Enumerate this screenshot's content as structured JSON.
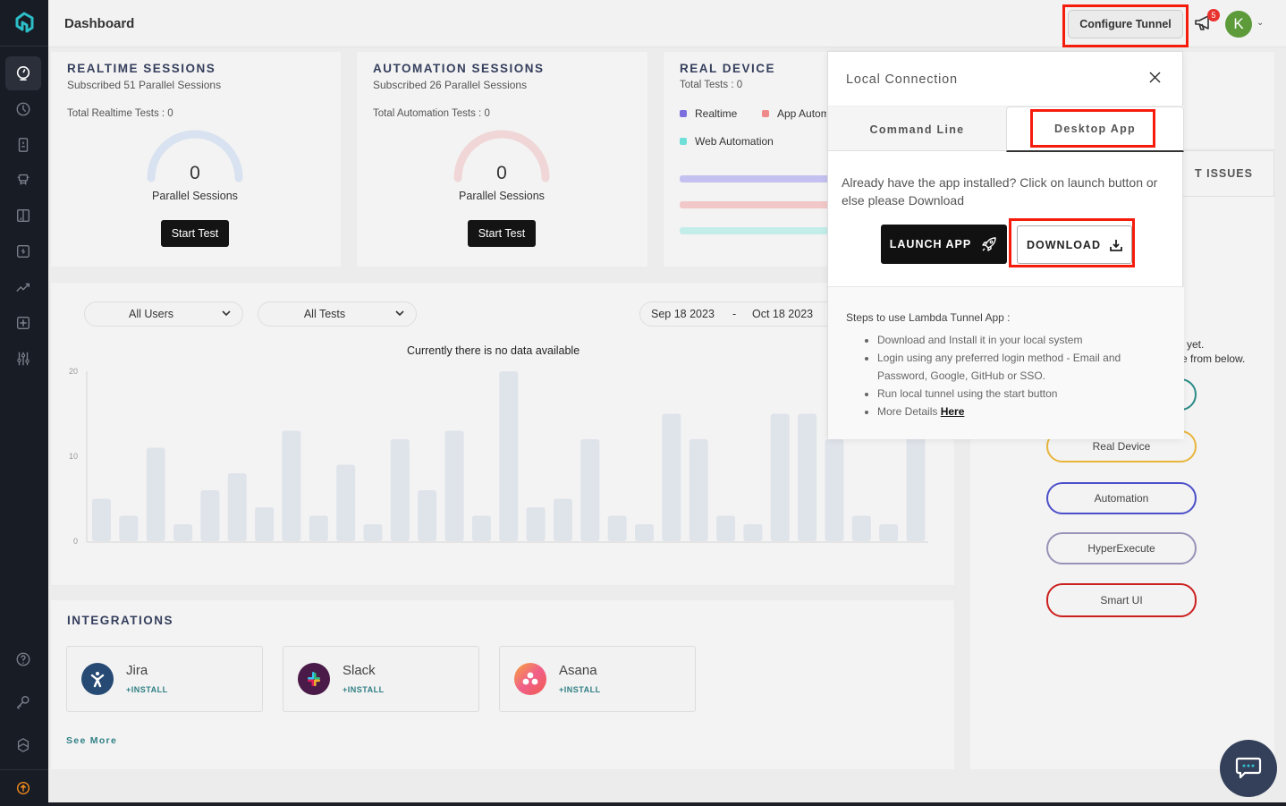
{
  "header": {
    "title": "Dashboard",
    "configure_tunnel": "Configure Tunnel",
    "notification_count": "5",
    "avatar_initial": "K"
  },
  "sidebar": {
    "items": [
      {
        "icon": "dashboard-icon",
        "active": true
      },
      {
        "icon": "history-clock-icon"
      },
      {
        "icon": "real-device-icon"
      },
      {
        "icon": "automation-robot-icon"
      },
      {
        "icon": "visual-compare-icon"
      },
      {
        "icon": "hyperexecute-icon"
      },
      {
        "icon": "analytics-icon"
      },
      {
        "icon": "add-integration-icon"
      },
      {
        "icon": "settings-sliders-icon"
      }
    ],
    "bottom_items": [
      {
        "icon": "help-icon"
      },
      {
        "icon": "access-key-icon"
      },
      {
        "icon": "integrations-icon"
      },
      {
        "icon": "upgrade-icon"
      }
    ]
  },
  "realtime": {
    "title": "REALTIME SESSIONS",
    "subscribed": "Subscribed 51 Parallel Sessions",
    "total": "Total Realtime Tests : 0",
    "value": "0",
    "label": "Parallel Sessions",
    "button": "Start Test"
  },
  "automation": {
    "title": "AUTOMATION SESSIONS",
    "subscribed": "Subscribed 26 Parallel Sessions",
    "total": "Total Automation Tests : 0",
    "value": "0",
    "label": "Parallel Sessions",
    "button": "Start Test"
  },
  "real_device": {
    "title": "REAL DEVICE",
    "total": "Total Tests : 0",
    "legend": [
      {
        "label": "Realtime",
        "color": "#7b6fe0"
      },
      {
        "label": "App Automation",
        "color": "#f08a8a"
      },
      {
        "label": "Web Automation",
        "color": "#6fe0d8"
      }
    ],
    "bar_colors": [
      "#c4c0ef",
      "#f2c7c7",
      "#c3ede9"
    ]
  },
  "filters": {
    "users": "All Users",
    "tests": "All Tests",
    "date_from": "Sep 18 2023",
    "date_sep": "-",
    "date_to": "Oct 18 2023"
  },
  "chart_data": {
    "type": "bar",
    "title": "Currently there is no data available",
    "xlabel": "",
    "ylabel": "",
    "ylim": [
      0,
      20
    ],
    "yticks": [
      "0",
      "10",
      "20"
    ],
    "grid": false,
    "placeholder": true,
    "values": [
      5,
      3,
      11,
      2,
      6,
      8,
      4,
      13,
      3,
      9,
      2,
      12,
      6,
      13,
      3,
      20,
      4,
      5,
      12,
      3,
      2,
      15,
      12,
      3,
      2,
      15,
      15,
      12,
      3,
      2,
      15
    ]
  },
  "right_panel": {
    "issues_title": "T ISSUES",
    "msg_line1": "yet.",
    "msg_line2": "e from below.",
    "pills": [
      {
        "label": "",
        "color": "#2a8a86"
      },
      {
        "label": "Real Device",
        "color": "#e8b53a"
      },
      {
        "label": "Automation",
        "color": "#4b4fc9"
      },
      {
        "label": "HyperExecute",
        "color": "#9a92b8"
      },
      {
        "label": "Smart UI",
        "color": "#cc1f1f"
      }
    ]
  },
  "integrations": {
    "title": "INTEGRATIONS",
    "items": [
      {
        "name": "Jira",
        "action": "+INSTALL"
      },
      {
        "name": "Slack",
        "action": "+INSTALL"
      },
      {
        "name": "Asana",
        "action": "+INSTALL"
      }
    ],
    "see_more": "See More"
  },
  "popover": {
    "title": "Local Connection",
    "tabs": [
      "Command Line",
      "Desktop App"
    ],
    "active_tab": "Desktop App",
    "description": "Already have the app installed? Click on launch button or else please Download",
    "launch_label": "LAUNCH APP",
    "download_label": "DOWNLOAD",
    "steps_title": "Steps to use Lambda Tunnel App :",
    "steps": [
      "Download and Install it in your local system",
      "Login using any preferred login method - Email and Password, Google, GitHub or SSO.",
      "Run local tunnel using the start button",
      "More Details "
    ],
    "here_link": "Here"
  }
}
